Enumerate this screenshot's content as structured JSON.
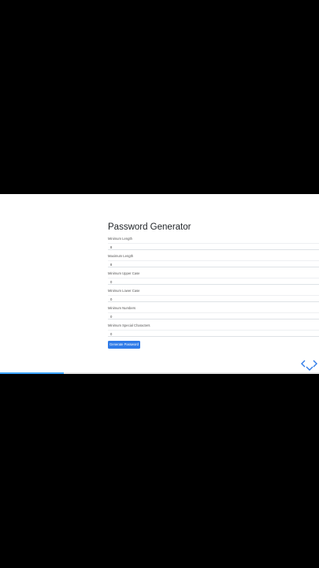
{
  "form": {
    "title": "Password Generator",
    "fields": [
      {
        "label": "Minimum Length",
        "value": "8"
      },
      {
        "label": "Maximum Length",
        "value": "8"
      },
      {
        "label": "Minimum Upper Case",
        "value": "0"
      },
      {
        "label": "Minimum Lower Case",
        "value": "0"
      },
      {
        "label": "Minimum Numbers",
        "value": "0"
      },
      {
        "label": "Minimum Special Characters",
        "value": "0"
      }
    ],
    "generate_label": "Generate Password"
  },
  "player": {
    "progress_fraction": 0.2,
    "icons": [
      "chevron-left-icon",
      "chevron-right-icon",
      "chevron-down-icon"
    ],
    "accent_color": "#2f7be8",
    "progress_color": "#3ea6ff"
  }
}
